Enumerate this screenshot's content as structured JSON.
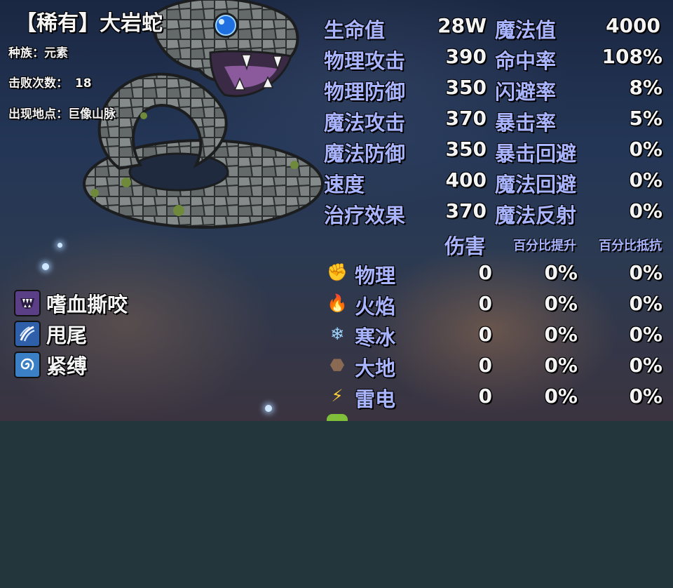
{
  "monster": {
    "title": "【稀有】大岩蛇",
    "race": "种族：元素",
    "defeats_label": "击败次数：",
    "defeats": "18",
    "location": "出现地点：巨像山脉"
  },
  "skills": [
    {
      "name": "嗜血撕咬",
      "icon": "fang-icon",
      "color": "#5b3f86"
    },
    {
      "name": "甩尾",
      "icon": "tail-wave-icon",
      "color": "#2f5fa8"
    },
    {
      "name": "紧缚",
      "icon": "swirl-icon",
      "color": "#3b7fc4"
    }
  ],
  "stats": [
    {
      "l1": "生命值",
      "v1": "28W",
      "l2": "魔法值",
      "v2": "4000"
    },
    {
      "l1": "物理攻击",
      "v1": "390",
      "l2": "命中率",
      "v2": "108%"
    },
    {
      "l1": "物理防御",
      "v1": "350",
      "l2": "闪避率",
      "v2": "8%"
    },
    {
      "l1": "魔法攻击",
      "v1": "370",
      "l2": "暴击率",
      "v2": "5%"
    },
    {
      "l1": "魔法防御",
      "v1": "350",
      "l2": "暴击回避",
      "v2": "0%"
    },
    {
      "l1": "速度",
      "v1": "400",
      "l2": "魔法回避",
      "v2": "0%"
    },
    {
      "l1": "治疗效果",
      "v1": "370",
      "l2": "魔法反射",
      "v2": "0%"
    }
  ],
  "damage_header": {
    "damage": "伤害",
    "pct_up": "百分比提升",
    "pct_res": "百分比抵抗"
  },
  "elements": [
    {
      "name": "物理",
      "icon": "fist-icon",
      "glyph": "✊",
      "color": "#e8a07a",
      "damage": "0",
      "up": "0%",
      "res": "0%"
    },
    {
      "name": "火焰",
      "icon": "fire-icon",
      "glyph": "🔥",
      "color": "#f2a431",
      "damage": "0",
      "up": "0%",
      "res": "0%"
    },
    {
      "name": "寒冰",
      "icon": "snowflake-icon",
      "glyph": "❄",
      "color": "#9fd6ff",
      "damage": "0",
      "up": "0%",
      "res": "0%"
    },
    {
      "name": "大地",
      "icon": "rock-icon",
      "glyph": "⬣",
      "color": "#8a6a52",
      "damage": "0",
      "up": "0%",
      "res": "0%"
    },
    {
      "name": "雷电",
      "icon": "lightning-icon",
      "glyph": "⚡",
      "color": "#ffd23a",
      "damage": "0",
      "up": "0%",
      "res": "0%"
    }
  ]
}
